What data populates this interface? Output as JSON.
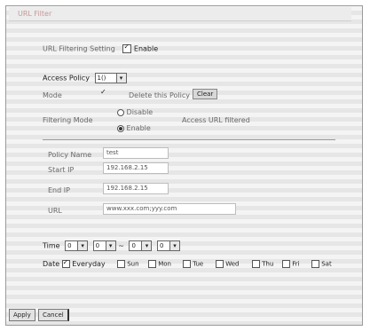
{
  "header": {
    "title": "URL Filter"
  },
  "enable_row": {
    "label": "URL Filtering Setting",
    "checkbox_label": "Enable",
    "checked": true
  },
  "access_policy": {
    "label": "Access Policy",
    "value": "1()"
  },
  "mode_row": {
    "label": "Mode",
    "checked": true,
    "delete_label": "Delete this Policy",
    "clear_label": "Clear"
  },
  "filtering_mode": {
    "label": "Filtering Mode",
    "option_disable": "Disable",
    "option_enable": "Enable",
    "selected": "enable",
    "link": "Access URL filtered"
  },
  "fields": [
    {
      "label": "Policy Name",
      "value": "test"
    },
    {
      "label": "Start IP",
      "value": "192.168.2.15"
    },
    {
      "label": "End IP",
      "value": "192.168.2.15"
    },
    {
      "label": "URL",
      "value": "www.xxx.com;yyy.com"
    }
  ],
  "time": {
    "label": "Time",
    "start_hour": "0",
    "start_min": "0",
    "separator": "~",
    "end_hour": "0",
    "end_min": "0"
  },
  "days": {
    "label": "Date",
    "everyday_label": "Everyday",
    "everyday_checked": true,
    "items": [
      "Sun",
      "Mon",
      "Tue",
      "Wed",
      "Thu",
      "Fri",
      "Sat"
    ]
  },
  "footer": {
    "apply_label": "Apply",
    "cancel_label": "Cancel"
  }
}
